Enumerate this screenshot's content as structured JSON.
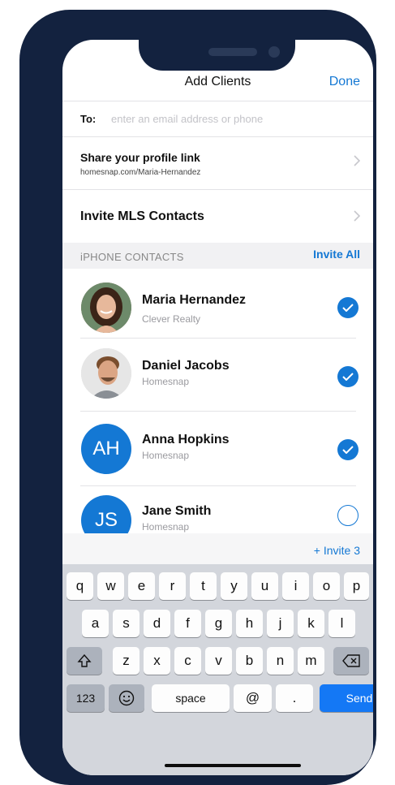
{
  "nav": {
    "title": "Add Clients",
    "done": "Done"
  },
  "to_field": {
    "label": "To:",
    "placeholder": "enter an email address or phone",
    "value": ""
  },
  "share_row": {
    "title": "Share your profile link",
    "url": "homesnap.com/Maria-Hernandez"
  },
  "mls_row": {
    "title": "Invite MLS Contacts"
  },
  "section": {
    "label": "iPHONE CONTACTS",
    "invite_all": "Invite All"
  },
  "contacts": [
    {
      "name": "Maria Hernandez",
      "org": "Clever Realty",
      "initials": "",
      "selected": true
    },
    {
      "name": "Daniel Jacobs",
      "org": "Homesnap",
      "initials": "",
      "selected": true
    },
    {
      "name": "Anna Hopkins",
      "org": "Homesnap",
      "initials": "AH",
      "selected": true
    },
    {
      "name": "Jane Smith",
      "org": "Homesnap",
      "initials": "JS",
      "selected": false
    }
  ],
  "invite_button": "+ Invite 3",
  "keyboard": {
    "row1": [
      "q",
      "w",
      "e",
      "r",
      "t",
      "y",
      "u",
      "i",
      "o",
      "p"
    ],
    "row2": [
      "a",
      "s",
      "d",
      "f",
      "g",
      "h",
      "j",
      "k",
      "l"
    ],
    "row3": [
      "z",
      "x",
      "c",
      "v",
      "b",
      "n",
      "m"
    ],
    "numbers": "123",
    "space": "space",
    "at": "@",
    "dot": ".",
    "send": "Send"
  },
  "icons": {
    "chevron": "chevron-right-icon",
    "check": "checkmark-icon",
    "shift": "shift-icon",
    "delete": "delete-icon",
    "emoji": "emoji-icon"
  },
  "colors": {
    "accent": "#1478d4",
    "send": "#1478f5",
    "frame": "#13223f"
  }
}
